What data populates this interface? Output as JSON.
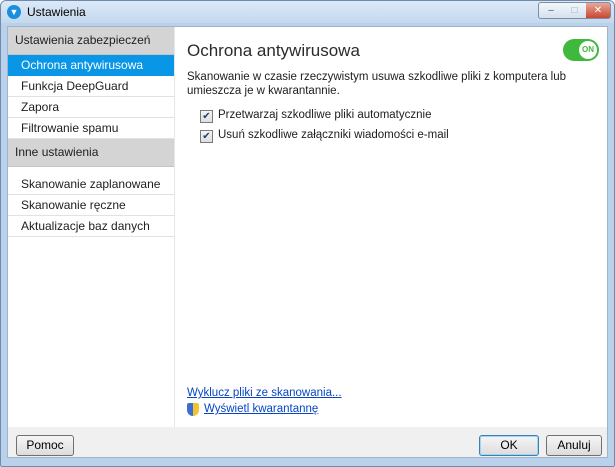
{
  "window": {
    "title": "Ustawienia",
    "controls": {
      "minimize": "–",
      "maximize": "□",
      "close": "✕"
    }
  },
  "sidebar": {
    "groups": [
      {
        "header": "Ustawienia zabezpieczeń",
        "items": [
          {
            "label": "Ochrona antywirusowa",
            "selected": true
          },
          {
            "label": "Funkcja DeepGuard"
          },
          {
            "label": "Zapora"
          },
          {
            "label": "Filtrowanie spamu"
          }
        ]
      },
      {
        "header": "Inne ustawienia",
        "items": [
          {
            "label": "Skanowanie zaplanowane"
          },
          {
            "label": "Skanowanie ręczne"
          },
          {
            "label": "Aktualizacje baz danych"
          }
        ]
      }
    ]
  },
  "main": {
    "title": "Ochrona antywirusowa",
    "toggle": {
      "label": "ON",
      "state": "on",
      "color": "#3fb93d"
    },
    "description": "Skanowanie w czasie rzeczywistym usuwa szkodliwe pliki z komputera lub umieszcza je w kwarantannie.",
    "options": [
      {
        "label": "Przetwarzaj szkodliwe pliki automatycznie",
        "checked": true
      },
      {
        "label": "Usuń szkodliwe załączniki wiadomości e-mail",
        "checked": true
      }
    ],
    "links": {
      "exclude": "Wyklucz pliki ze skanowania...",
      "quarantine": "Wyświetl kwarantannę",
      "quarantine_icon": "shield-icon"
    }
  },
  "footer": {
    "help": "Pomoc",
    "ok": "OK",
    "cancel": "Anuluj"
  },
  "colors": {
    "selection": "#0a96e6",
    "toggle_on": "#3fb93d",
    "link": "#0645c2"
  }
}
